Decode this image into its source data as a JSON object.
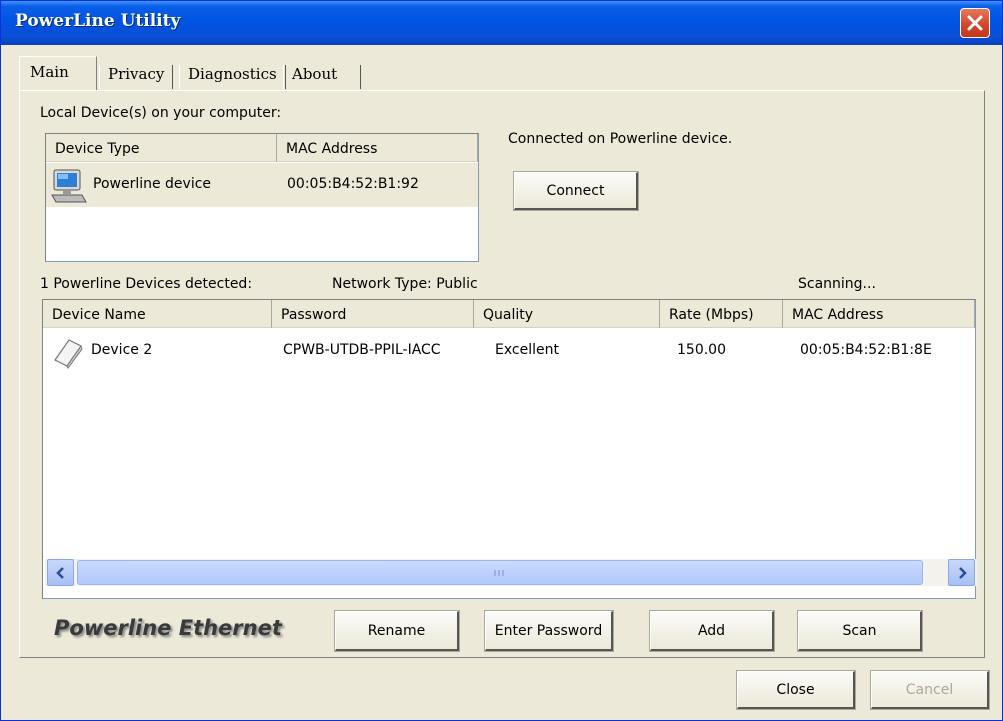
{
  "window": {
    "title": "PowerLine Utility"
  },
  "tabs": [
    "Main",
    "Privacy",
    "Diagnostics",
    "About"
  ],
  "local": {
    "label": "Local Device(s) on your computer:",
    "columns": [
      "Device Type",
      "MAC Address"
    ],
    "rows": [
      {
        "type": "Powerline device",
        "mac": "00:05:B4:52:B1:92",
        "icon": "computer-icon"
      }
    ]
  },
  "status": {
    "connected_text": "Connected on Powerline device.",
    "connect_label": "Connect"
  },
  "network": {
    "detected_text": "1 Powerline Devices detected:",
    "type_text": "Network Type: Public",
    "scanning_text": "Scanning...",
    "columns": [
      "Device Name",
      "Password",
      "Quality",
      "Rate (Mbps)",
      "MAC Address"
    ],
    "rows": [
      {
        "name": "Device 2",
        "password": "CPWB-UTDB-PPIL-IACC",
        "quality": "Excellent",
        "rate": "150.00",
        "mac": "00:05:B4:52:B1:8E",
        "icon": "powerline-adapter-icon"
      }
    ]
  },
  "brand": "Powerline Ethernet",
  "actions": {
    "rename": "Rename",
    "enter_password": "Enter Password",
    "add": "Add",
    "scan": "Scan"
  },
  "footer": {
    "close": "Close",
    "cancel": "Cancel"
  },
  "colors": {
    "titlebar": "#0054e3",
    "close_button": "#d0452a",
    "scroll_thumb": "#b0c8fb"
  }
}
